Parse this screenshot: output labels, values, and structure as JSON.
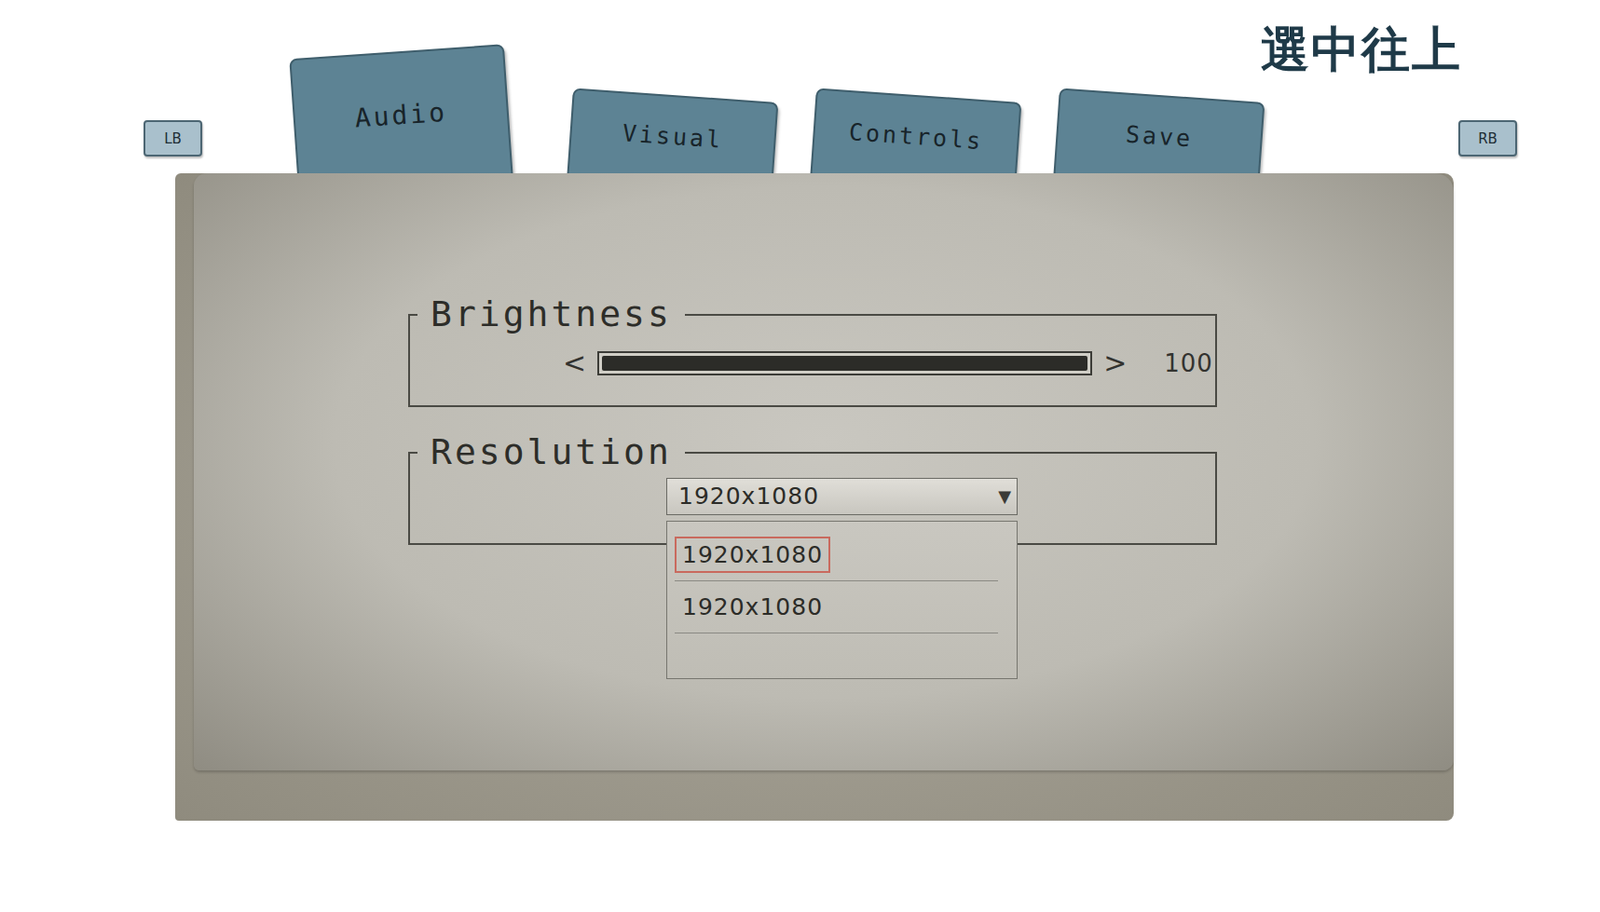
{
  "hint": "選中往上",
  "shoulder_buttons": {
    "left": "LB",
    "right": "RB"
  },
  "tabs": [
    {
      "label": "Audio",
      "selected": true
    },
    {
      "label": "Visual",
      "selected": false
    },
    {
      "label": "Controls",
      "selected": false
    },
    {
      "label": "Save",
      "selected": false
    }
  ],
  "brightness": {
    "label": "Brightness",
    "decrease": "<",
    "increase": ">",
    "level": 1.0,
    "reading": "100"
  },
  "resolution": {
    "label": "Resolution",
    "value": "1920x1080",
    "arrow": "▼",
    "expanded": true,
    "options": [
      {
        "label": "1920x1080",
        "selected": true
      },
      {
        "label": "1920x1080",
        "selected": false
      }
    ]
  }
}
